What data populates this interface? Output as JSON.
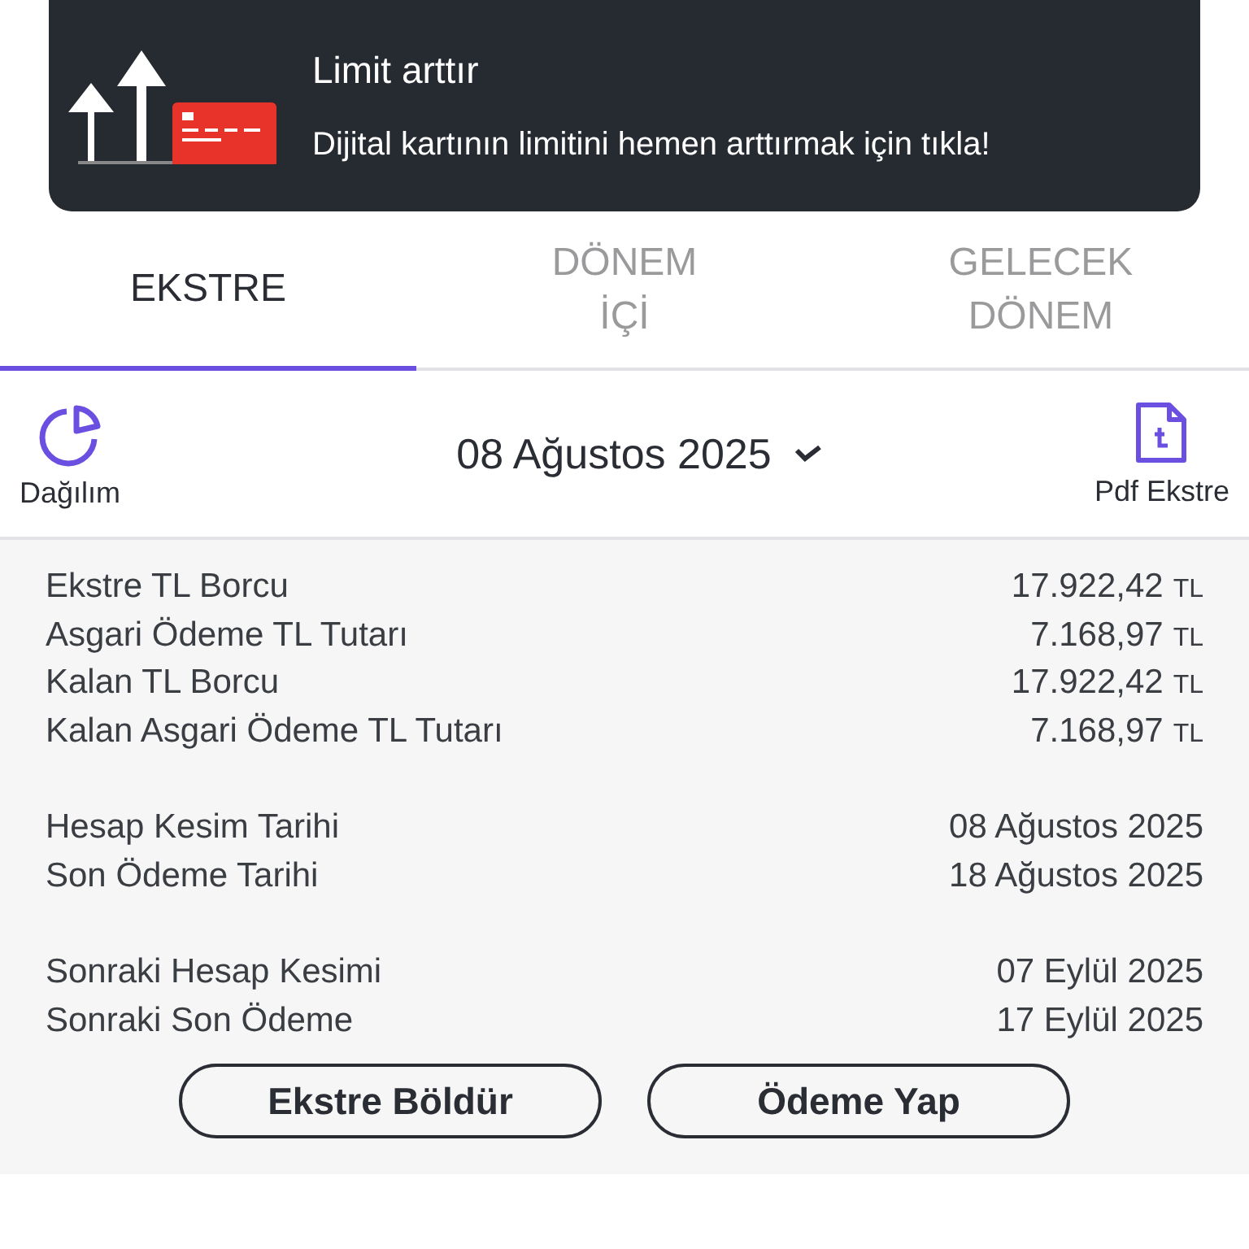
{
  "banner": {
    "title": "Limit arttır",
    "text": "Dijital kartının limitini hemen arttırmak için tıkla!"
  },
  "tabs": [
    {
      "label": "EKSTRE",
      "selected": true
    },
    {
      "label": "DÖNEM İÇİ",
      "selected": false
    },
    {
      "label": "GELECEK DÖNEM",
      "selected": false
    }
  ],
  "header": {
    "left_label": "Dağılım",
    "date": "08 Ağustos 2025",
    "right_label": "Pdf Ekstre"
  },
  "summary": {
    "groups": [
      [
        {
          "label": "Ekstre TL Borcu",
          "value": "17.922,42",
          "currency": "TL"
        },
        {
          "label": "Asgari Ödeme TL Tutarı",
          "value": "7.168,97",
          "currency": "TL"
        },
        {
          "label": "Kalan TL Borcu",
          "value": "17.922,42",
          "currency": "TL"
        },
        {
          "label": "Kalan Asgari Ödeme TL Tutarı",
          "value": "7.168,97",
          "currency": "TL"
        }
      ],
      [
        {
          "label": "Hesap Kesim Tarihi",
          "value": "08 Ağustos 2025"
        },
        {
          "label": "Son Ödeme Tarihi",
          "value": "18 Ağustos 2025"
        }
      ],
      [
        {
          "label": "Sonraki Hesap Kesimi",
          "value": "07 Eylül 2025"
        },
        {
          "label": "Sonraki Son Ödeme",
          "value": "17 Eylül 2025"
        }
      ]
    ]
  },
  "buttons": [
    "Ekstre Böldür",
    "Ödeme Yap"
  ]
}
